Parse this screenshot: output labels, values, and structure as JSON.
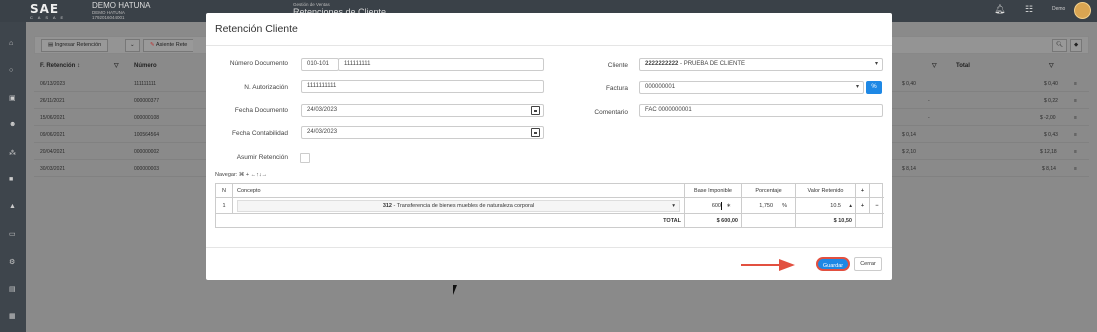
{
  "app": {
    "logo": "SAE",
    "logo_sub": "C A S A E",
    "company_name": "DEMO HATUNA",
    "company_sub1": "DEMO HATUNA",
    "company_sub2": "1792016044001",
    "module_label": "Gestión de Ventas",
    "module_title": "Retenciones de Cliente",
    "user_name": "Demo"
  },
  "background": {
    "toolbar": {
      "ingresar_label": "Ingresar Retención",
      "asiento_label": "Asiente Rete"
    },
    "columns": {
      "fecha": "F. Retención",
      "numero": "Número",
      "total": "Total"
    },
    "rows": [
      {
        "fecha": "06/13/2023",
        "numero": "111111111",
        "val1": "$ 0,40",
        "total": "$ 0,40"
      },
      {
        "fecha": "26/11/2021",
        "numero": "000000377",
        "val1": "-",
        "total": "$ 0,22"
      },
      {
        "fecha": "15/06/2021",
        "numero": "000000108",
        "val1": "-",
        "total": "$ -2,00"
      },
      {
        "fecha": "09/06/2021",
        "numero": "100564564",
        "val1": "$ 0,14",
        "total": "$ 0,43"
      },
      {
        "fecha": "20/04/2021",
        "numero": "000000002",
        "val1": "$ 2,10",
        "total": "$ 12,18"
      },
      {
        "fecha": "30/03/2021",
        "numero": "000000003",
        "val1": "$ 8,14",
        "total": "$ 8,14"
      }
    ]
  },
  "modal": {
    "title": "Retención Cliente",
    "numero_documento_label": "Número Documento",
    "serie": "010-101",
    "numero": "111111111",
    "autorizacion_label": "N. Autorización",
    "autorizacion": "1111111111",
    "fecha_documento_label": "Fecha Documento",
    "fecha_documento": "24/03/2023",
    "fecha_contabilidad_label": "Fecha Contabilidad",
    "fecha_contabilidad": "24/03/2023",
    "asumir_label": "Asumir Retención",
    "cliente_label": "Cliente",
    "cliente_ruc": "2222222222",
    "cliente_name": " - PRUEBA DE CLIENTE",
    "factura_label": "Factura",
    "factura": "000000001",
    "factura_btn": "%",
    "comentario_label": "Comentario",
    "comentario": "FAC 0000000001",
    "nav_hint": "Navegar: ⌘ + ←↑↓→",
    "table": {
      "headers": {
        "n": "N",
        "concepto": "Concepto",
        "base": "Base Imponible",
        "porcentaje": "Porcentaje",
        "valor": "Valor Retenido",
        "plus": "+"
      },
      "row": {
        "n": "1",
        "codigo": "312",
        "concepto": " - Transferencia de bienes muebles de naturaleza corporal",
        "base": "600",
        "porcentaje": "1,750",
        "pct_sign": "%",
        "valor": "10.5",
        "plus": "+",
        "minus": "−"
      },
      "total_label": "TOTAL",
      "total_base": "$ 600,00",
      "total_valor": "$ 10,50"
    },
    "guardar_label": "Guardar",
    "cerrar_label": "Cerrar"
  },
  "colors": {
    "primary": "#1e88e5",
    "annotation": "#e25040"
  }
}
